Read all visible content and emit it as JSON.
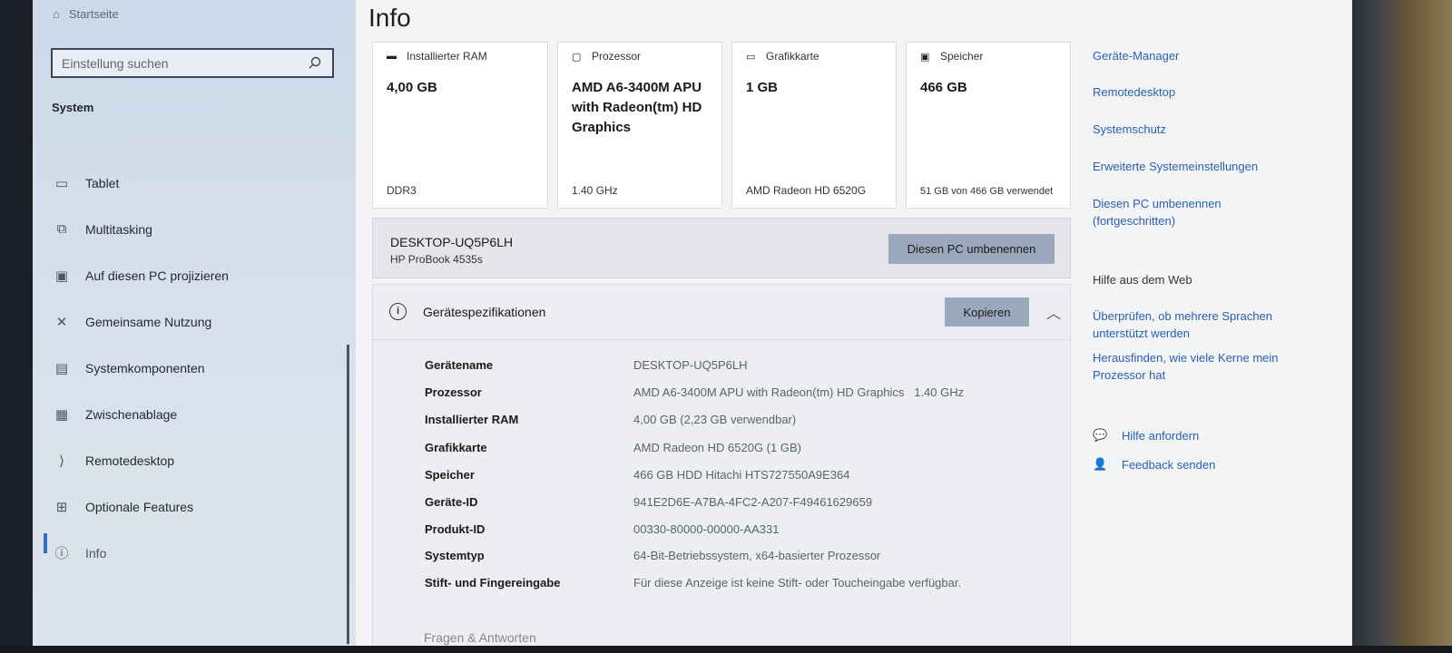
{
  "sidebar": {
    "home": "Startseite",
    "search_placeholder": "Einstellung suchen",
    "section": "System",
    "items": [
      {
        "label": "Tablet",
        "icon": "tablet-icon"
      },
      {
        "label": "Multitasking",
        "icon": "multitasking-icon"
      },
      {
        "label": "Auf diesen PC projizieren",
        "icon": "project-icon"
      },
      {
        "label": "Gemeinsame Nutzung",
        "icon": "share-icon"
      },
      {
        "label": "Systemkomponenten",
        "icon": "components-icon"
      },
      {
        "label": "Zwischenablage",
        "icon": "clipboard-icon"
      },
      {
        "label": "Remotedesktop",
        "icon": "remote-desktop-icon"
      },
      {
        "label": "Optionale Features",
        "icon": "features-icon"
      },
      {
        "label": "Info",
        "icon": "info-icon"
      }
    ]
  },
  "main": {
    "title": "Info",
    "cards": [
      {
        "label": "Installierter RAM",
        "value": "4,00 GB",
        "foot": "DDR3",
        "icon": "ram-icon"
      },
      {
        "label": "Prozessor",
        "value": "AMD A6-3400M APU with Radeon(tm) HD Graphics",
        "foot": "1.40 GHz",
        "icon": "cpu-icon"
      },
      {
        "label": "Grafikkarte",
        "value": "1 GB",
        "foot": "AMD Radeon HD 6520G",
        "icon": "gpu-icon"
      },
      {
        "label": "Speicher",
        "value": "466 GB",
        "foot": "51 GB von 466 GB verwendet",
        "icon": "storage-icon"
      }
    ],
    "pc": {
      "name": "DESKTOP-UQ5P6LH",
      "model": "HP ProBook 4535s",
      "rename_label": "Diesen PC umbenennen"
    },
    "specs": {
      "title": "Gerätespezifikationen",
      "copy_label": "Kopieren",
      "rows": [
        {
          "k": "Gerätename",
          "v": "DESKTOP-UQ5P6LH"
        },
        {
          "k": "Prozessor",
          "v": "AMD A6-3400M APU with Radeon(tm) HD Graphics   1.40 GHz"
        },
        {
          "k": "Installierter RAM",
          "v": "4,00 GB (2,23 GB verwendbar)"
        },
        {
          "k": "Grafikkarte",
          "v": "AMD Radeon HD 6520G (1 GB)"
        },
        {
          "k": "Speicher",
          "v": "466 GB HDD Hitachi HTS727550A9E364"
        },
        {
          "k": "Geräte-ID",
          "v": "941E2D6E-A7BA-4FC2-A207-F49461629659"
        },
        {
          "k": "Produkt-ID",
          "v": "00330-80000-00000-AA331"
        },
        {
          "k": "Systemtyp",
          "v": "64-Bit-Betriebssystem, x64-basierter Prozessor"
        },
        {
          "k": "Stift- und Fingereingabe",
          "v": "Für diese Anzeige ist keine Stift- oder Toucheingabe verfügbar."
        }
      ],
      "faq": "Fragen & Antworten"
    }
  },
  "right": {
    "links": [
      "Geräte-Manager",
      "Remotedesktop",
      "Systemschutz",
      "Erweiterte Systemeinstellungen",
      "Diesen PC umbenennen (fortgeschritten)"
    ],
    "web_help_title": "Hilfe aus dem Web",
    "web_links": [
      "Überprüfen, ob mehrere Sprachen unterstützt werden",
      "Herausfinden, wie viele Kerne mein Prozessor hat"
    ],
    "help_label": "Hilfe anfordern",
    "feedback_label": "Feedback senden"
  }
}
